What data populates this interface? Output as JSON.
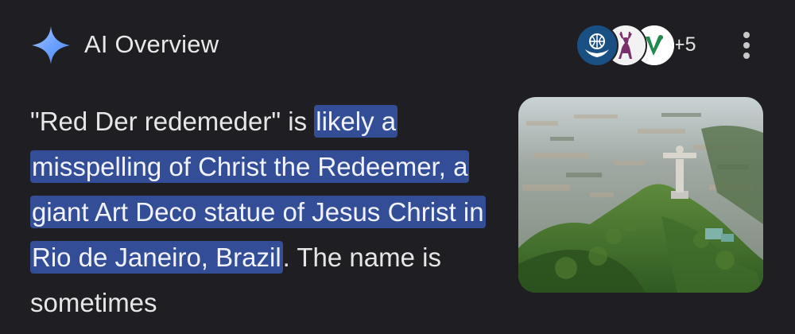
{
  "header": {
    "icon": "sparkle-icon",
    "title": "AI Overview",
    "sources": [
      {
        "icon": "globe-hands-logo-icon",
        "color": "#1a4f84"
      },
      {
        "icon": "red-deer-logo-icon",
        "color": "#7a2f6d"
      },
      {
        "icon": "green-v-logo-icon",
        "color": "#1f8a4c"
      }
    ],
    "more_count": "+5",
    "menu_icon": "more-vert-icon"
  },
  "overview": {
    "text_before": "\"Red Der redemeder\" is ",
    "highlight": "likely a misspelling of Christ the Redeemer, a giant Art Deco statue of Jesus Christ in Rio de Janeiro, Brazil",
    "text_after": ". The name is sometimes"
  },
  "image": {
    "icon": "christ-the-redeemer-photo"
  },
  "colors": {
    "background": "#1f1f23",
    "highlight": "#334d96",
    "text": "#e6e6e6"
  }
}
